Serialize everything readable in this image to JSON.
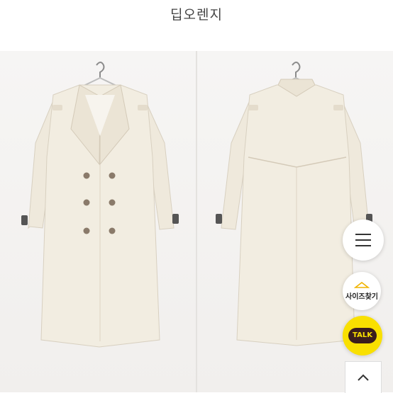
{
  "header": {
    "color_name": "딥오렌지"
  },
  "photo": {
    "alt": ""
  },
  "floating": {
    "menu": {
      "icon": "hamburger-menu-icon"
    },
    "size_finder": {
      "label": "사이즈찾기",
      "icon": "hanger-icon"
    },
    "kakao_talk": {
      "label": "TALK",
      "color": "#f9e000"
    },
    "scroll_top": {
      "icon": "chevron-up-icon"
    }
  }
}
